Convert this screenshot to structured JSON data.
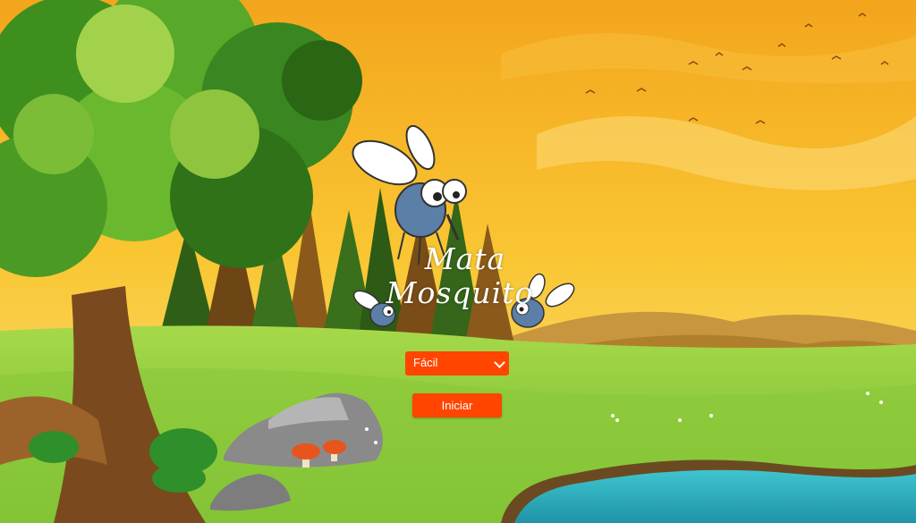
{
  "game": {
    "title_line1": "Mata",
    "title_line2": "Mosquito"
  },
  "menu": {
    "difficulty_selected": "Fácil",
    "start_label": "Iniciar"
  },
  "colors": {
    "button_bg": "#ff4500",
    "button_text": "#ffffff",
    "sky_top": "#f7b21c",
    "grass": "#8fcf3c",
    "water": "#2fb6c0"
  }
}
